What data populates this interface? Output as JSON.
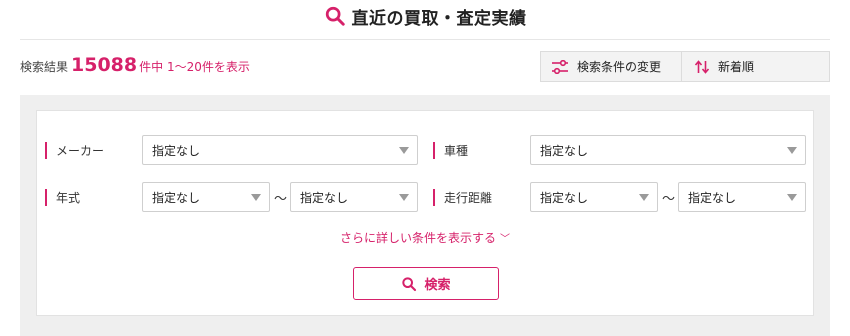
{
  "header": {
    "title": "直近の買取・査定実績",
    "icon": "search-icon"
  },
  "results": {
    "label": "検索結果",
    "count": "15088",
    "range": "件中 1〜20件を表示"
  },
  "toolbar": {
    "change_conditions": "検索条件の変更",
    "sort": "新着順"
  },
  "filters": {
    "maker": {
      "label": "メーカー",
      "value": "指定なし"
    },
    "model": {
      "label": "車種",
      "value": "指定なし"
    },
    "year": {
      "label": "年式",
      "from": "指定なし",
      "to": "指定なし",
      "separator": "〜"
    },
    "mileage": {
      "label": "走行距離",
      "from": "指定なし",
      "to": "指定なし",
      "separator": "〜"
    }
  },
  "more_conditions": "さらに詳しい条件を表示する",
  "search_button": "検索",
  "colors": {
    "accent": "#d6216a",
    "panel": "#efefef"
  }
}
